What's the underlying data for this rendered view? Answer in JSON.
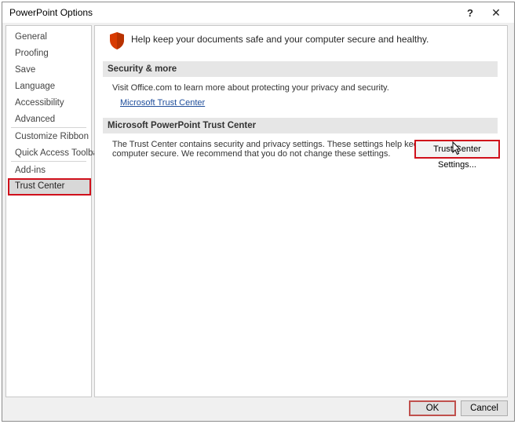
{
  "window": {
    "title": "PowerPoint Options",
    "help_glyph": "?",
    "close_glyph": "✕"
  },
  "nav": {
    "items": [
      {
        "label": "General"
      },
      {
        "label": "Proofing"
      },
      {
        "label": "Save"
      },
      {
        "label": "Language"
      },
      {
        "label": "Accessibility"
      },
      {
        "label": "Advanced"
      },
      {
        "label": "Customize Ribbon"
      },
      {
        "label": "Quick Access Toolbar"
      },
      {
        "label": "Add-ins"
      },
      {
        "label": "Trust Center",
        "selected": true
      }
    ]
  },
  "content": {
    "banner": "Help keep your documents safe and your computer secure and healthy.",
    "security_section": {
      "header": "Security & more",
      "text": "Visit Office.com to learn more about protecting your privacy and security.",
      "link": "Microsoft Trust Center"
    },
    "trust_center_section": {
      "header": "Microsoft PowerPoint Trust Center",
      "text_line1": "The Trust Center contains security and privacy settings. These settings help keep your",
      "text_line2": "computer secure. We recommend that you do not change these settings.",
      "button": "Trust Center Settings..."
    }
  },
  "footer": {
    "ok": "OK",
    "cancel": "Cancel"
  },
  "colors": {
    "accent_outline": "#d0101b",
    "shield": "#d83b01",
    "link": "#1f4e9b"
  },
  "icons": {
    "banner_icon": "shield-icon",
    "pointer": "mouse-cursor-icon"
  }
}
